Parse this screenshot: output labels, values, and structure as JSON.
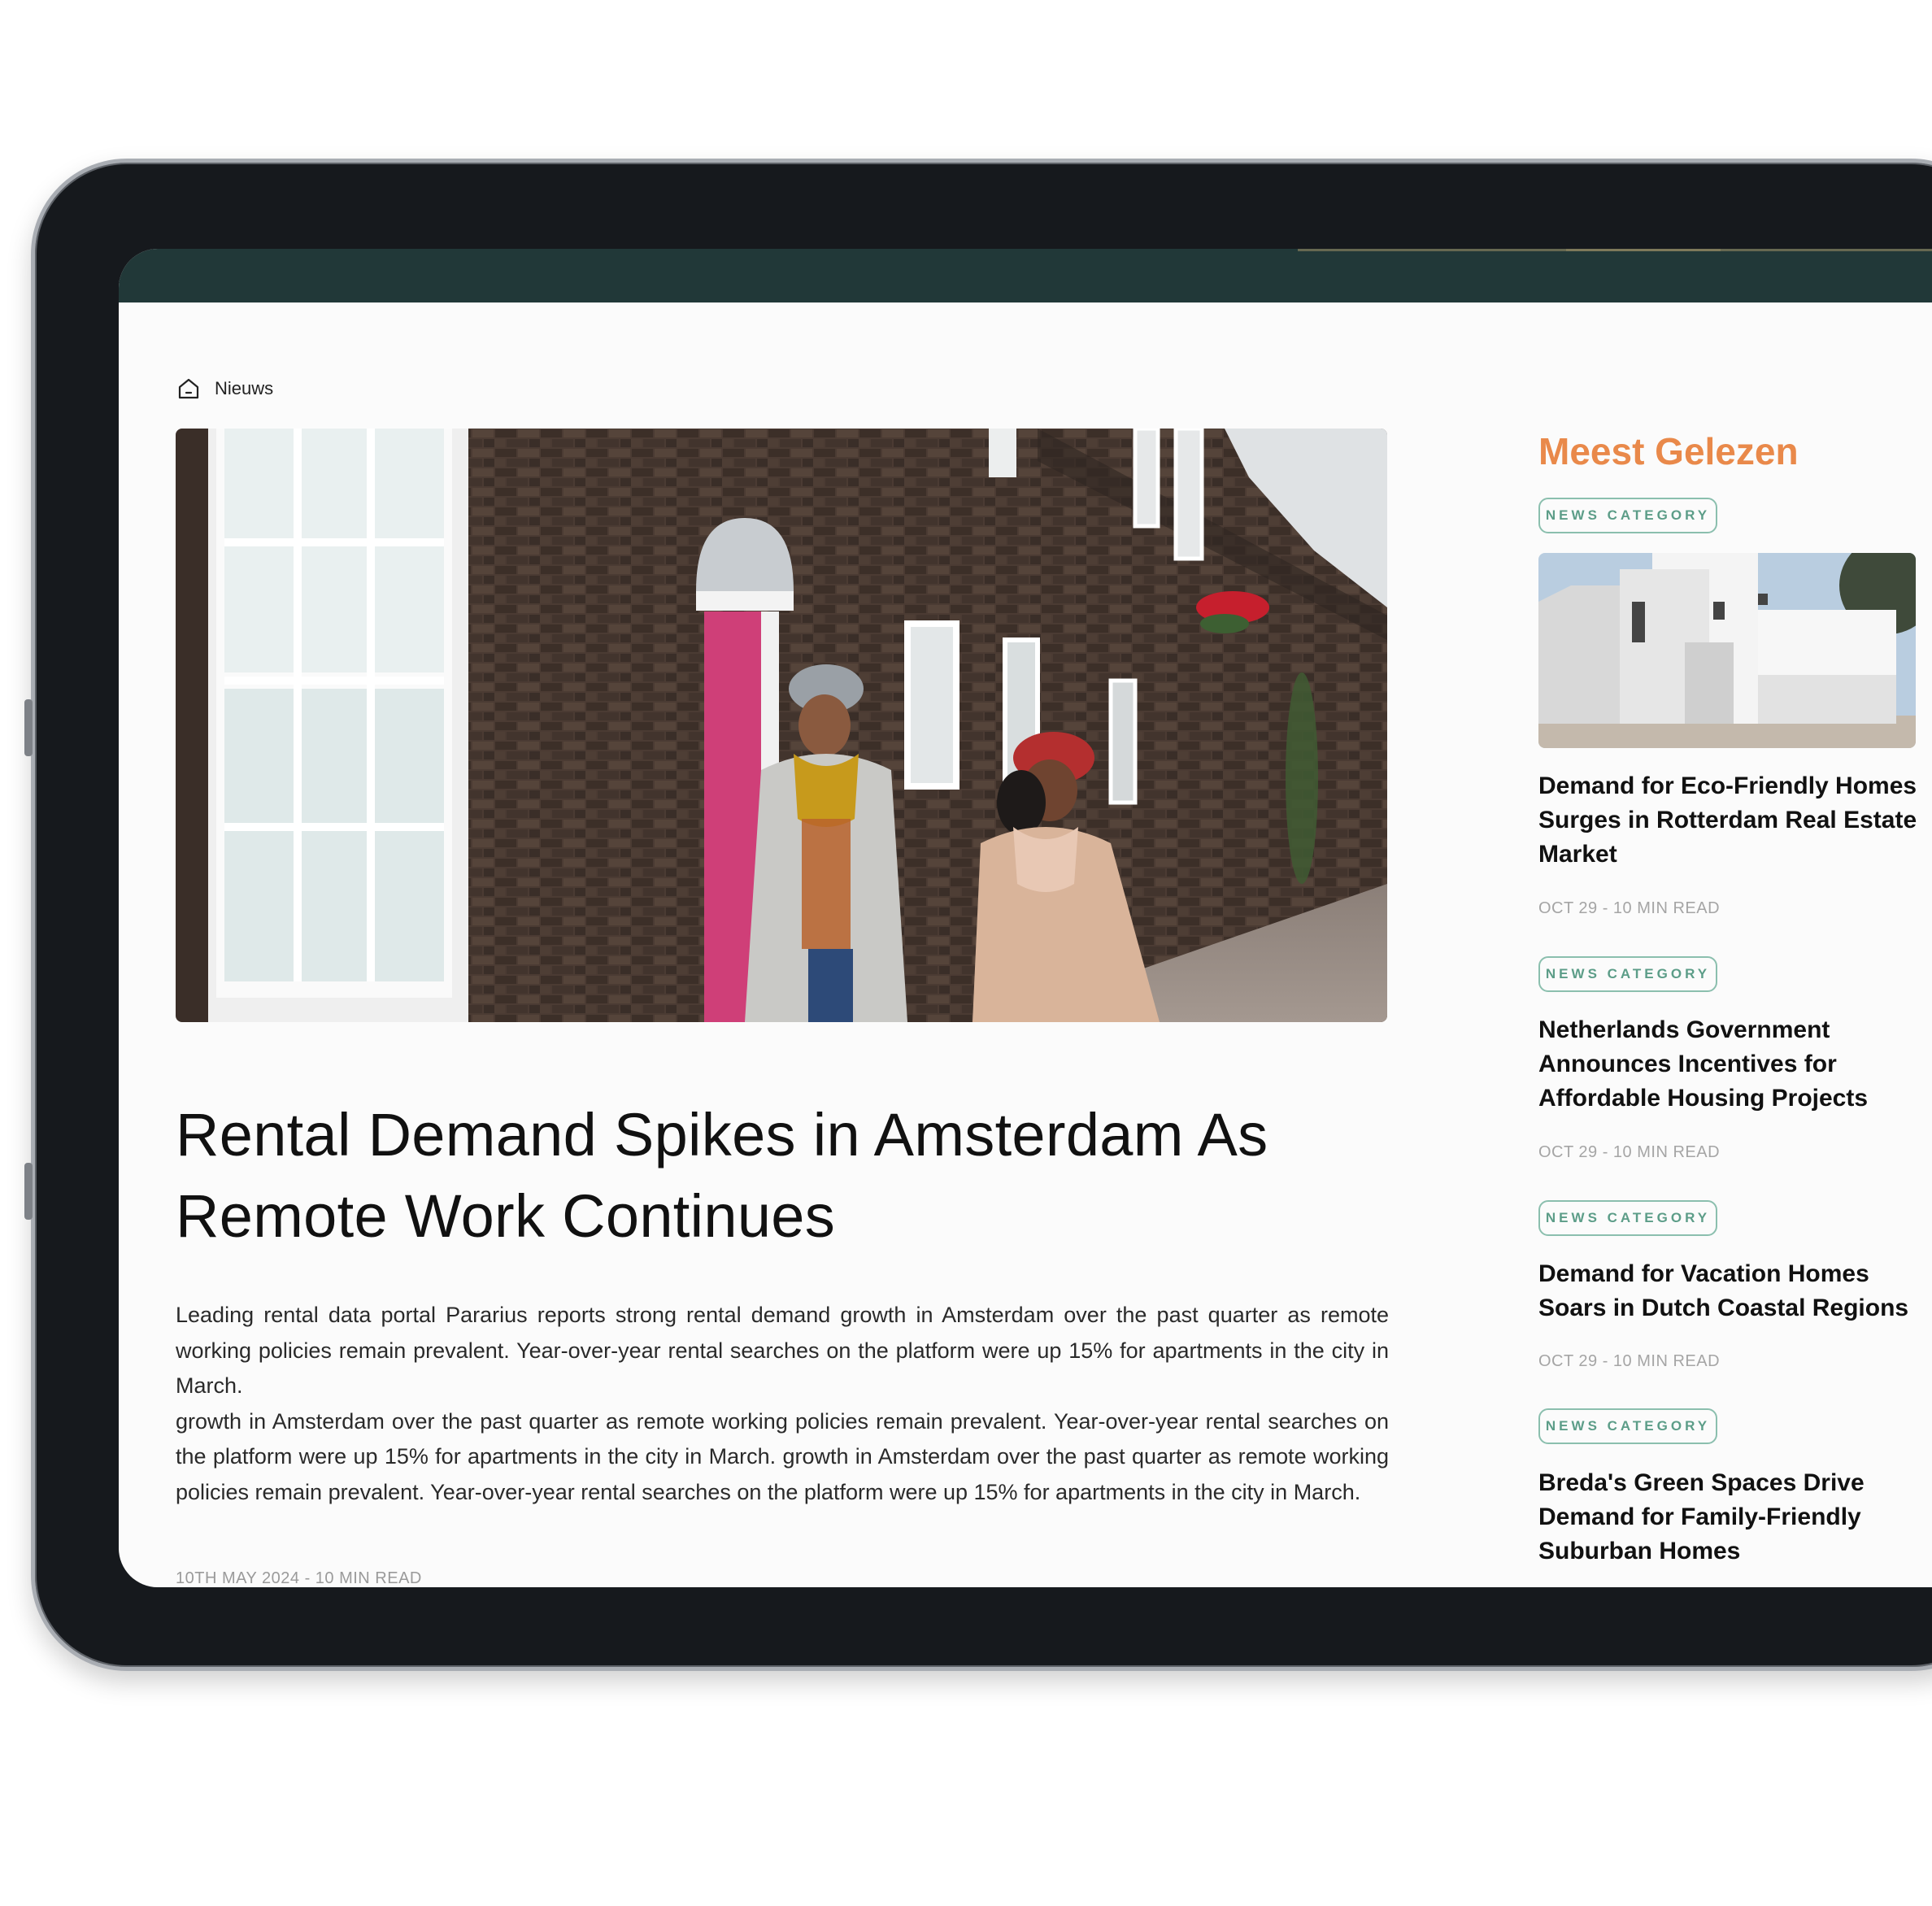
{
  "breadcrumb": {
    "icon": "home-icon",
    "label": "Nieuws"
  },
  "article": {
    "headline": "Rental Demand Spikes in Amsterdam As Remote Work Continues",
    "paragraph_1": "Leading rental data portal Pararius reports strong rental demand growth in Amsterdam over the past quarter as remote working policies remain prevalent. Year-over-year rental searches on the platform were up 15% for apartments in the city in March.",
    "paragraph_2": "growth in Amsterdam over the past quarter as remote working policies remain prevalent. Year-over-year rental searches on the platform were up 15% for apartments in the city in March. growth in Amsterdam over the past quarter as remote working policies remain prevalent. Year-over-year rental searches on the platform were up 15% for apartments in the city in March.",
    "meta": "10TH MAY 2024 - 10 MIN READ"
  },
  "sidebar": {
    "title": "Meest Gelezen",
    "items": [
      {
        "category": "NEWS CATEGORY",
        "headline": "Demand for Eco-Friendly Homes Surges in Rotterdam Real Estate Market",
        "meta": "OCT 29 - 10 MIN READ"
      },
      {
        "category": "NEWS CATEGORY",
        "headline": "Netherlands Government Announces Incentives for Affordable Housing Projects",
        "meta": "OCT 29 - 10 MIN READ"
      },
      {
        "category": "NEWS CATEGORY",
        "headline": "Demand for Vacation Homes Soars in Dutch Coastal Regions",
        "meta": "OCT 29 - 10 MIN READ"
      },
      {
        "category": "NEWS CATEGORY",
        "headline": "Breda's Green Spaces Drive Demand for Family-Friendly Suburban Homes"
      }
    ]
  },
  "colors": {
    "topbar": "#213838",
    "accent_orange": "#e9894a",
    "badge_green": "#5c9d88",
    "device_frame": "#16191d"
  }
}
